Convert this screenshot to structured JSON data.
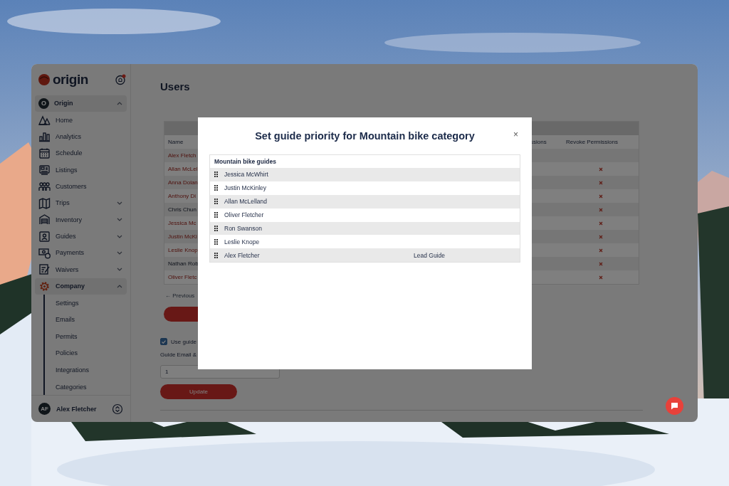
{
  "sidebar": {
    "logo": "origin",
    "workspace": {
      "avatar": "O",
      "label": "Origin",
      "expanded": true
    },
    "items": [
      {
        "label": "Home",
        "kind": "link",
        "selected": false
      },
      {
        "label": "Analytics",
        "kind": "link",
        "selected": false
      },
      {
        "label": "Schedule",
        "kind": "link",
        "selected": false
      },
      {
        "label": "Listings",
        "kind": "link",
        "selected": false
      },
      {
        "label": "Customers",
        "kind": "link",
        "selected": false
      },
      {
        "label": "Trips",
        "kind": "group",
        "expanded": false,
        "selected": false
      },
      {
        "label": "Inventory",
        "kind": "group",
        "expanded": false,
        "selected": false
      },
      {
        "label": "Guides",
        "kind": "group",
        "expanded": false,
        "selected": false
      },
      {
        "label": "Payments",
        "kind": "group",
        "expanded": false,
        "selected": false
      },
      {
        "label": "Waivers",
        "kind": "group",
        "expanded": false,
        "selected": false
      },
      {
        "label": "Company",
        "kind": "group",
        "expanded": true,
        "selected": true,
        "children": [
          {
            "label": "Settings"
          },
          {
            "label": "Emails"
          },
          {
            "label": "Permits"
          },
          {
            "label": "Policies"
          },
          {
            "label": "Integrations"
          },
          {
            "label": "Categories"
          }
        ]
      }
    ],
    "user": {
      "initials": "AF",
      "name": "Alex Fletcher"
    }
  },
  "page": {
    "title": "Users",
    "table": {
      "columns": [
        "Name",
        "ssions",
        "Revoke Permissions"
      ],
      "rows": [
        {
          "name": "Alex Fletch",
          "kind": "link",
          "revocable": false
        },
        {
          "name": "Allan McLel",
          "kind": "link",
          "revocable": true
        },
        {
          "name": "Anna Dolan",
          "kind": "link",
          "revocable": true
        },
        {
          "name": "Anthony Di",
          "kind": "link",
          "revocable": true
        },
        {
          "name": "Chris Chun",
          "kind": "text",
          "revocable": true
        },
        {
          "name": "Jessica Mc",
          "kind": "link",
          "revocable": true
        },
        {
          "name": "Justin McKi",
          "kind": "link",
          "revocable": true
        },
        {
          "name": "Leslie Knop",
          "kind": "link",
          "revocable": true
        },
        {
          "name": "Nathan Rob",
          "kind": "text",
          "revocable": true
        },
        {
          "name": "Oliver Fletc",
          "kind": "link",
          "revocable": true
        }
      ]
    },
    "pagination": "← Previous",
    "use_priority": {
      "label": "Use guide",
      "checked": true
    },
    "field": {
      "label": "Guide Email &",
      "value": "1"
    },
    "update_button": "Update"
  },
  "modal": {
    "title": "Set guide priority for Mountain bike category",
    "close": "×",
    "list_title": "Mountain bike guides",
    "guides": [
      {
        "name": "Jessica McWhirt"
      },
      {
        "name": "Justin McKinley"
      },
      {
        "name": "Allan McLelland"
      },
      {
        "name": "Oliver Fletcher"
      },
      {
        "name": "Ron Swanson"
      },
      {
        "name": "Leslie Knope"
      },
      {
        "name": "Alex Fletcher",
        "role": "Lead Guide"
      }
    ]
  }
}
